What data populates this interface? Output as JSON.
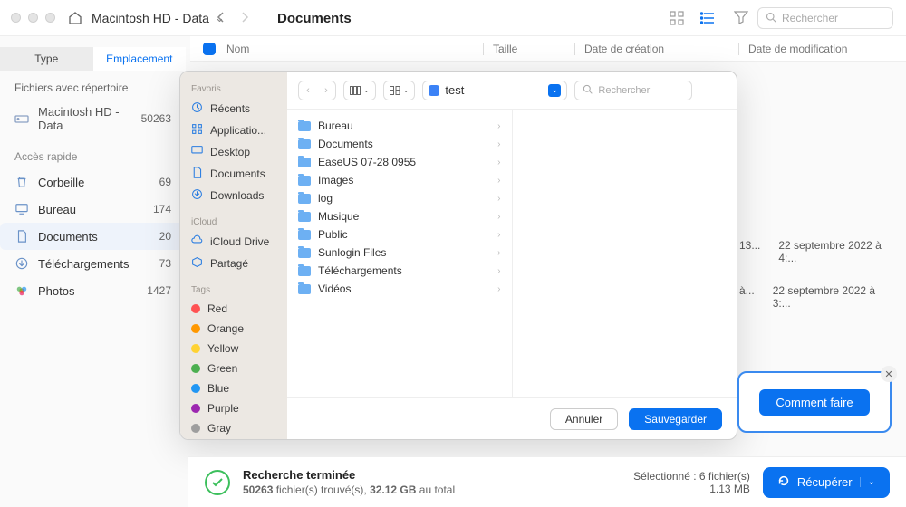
{
  "titlebar": {
    "path": "Macintosh HD - Data"
  },
  "toolbar": {
    "breadcrumb": "Documents",
    "search_placeholder": "Rechercher"
  },
  "columns": {
    "name": "Nom",
    "size": "Taille",
    "created": "Date de création",
    "modified": "Date de modification"
  },
  "sidebar": {
    "tabs": {
      "type": "Type",
      "location": "Emplacement"
    },
    "files_with_dir": "Fichiers avec répertoire",
    "device": {
      "name": "Macintosh HD - Data",
      "count": "50263"
    },
    "quick_h": "Accès rapide",
    "quick": [
      {
        "icon": "trash",
        "label": "Corbeille",
        "count": "69"
      },
      {
        "icon": "desktop",
        "label": "Bureau",
        "count": "174"
      },
      {
        "icon": "doc",
        "label": "Documents",
        "count": "20"
      },
      {
        "icon": "download",
        "label": "Téléchargements",
        "count": "73"
      },
      {
        "icon": "photos",
        "label": "Photos",
        "count": "1427"
      }
    ]
  },
  "peek_rows": [
    {
      "date1": "13...",
      "date2": "22 septembre 2022 à 4:..."
    },
    {
      "date1": "à...",
      "date2": "22 septembre 2022 à 3:..."
    }
  ],
  "dialog": {
    "sidebar": {
      "favorites_h": "Favoris",
      "favorites": [
        {
          "icon": "clock",
          "label": "Récents"
        },
        {
          "icon": "apps",
          "label": "Applicatio..."
        },
        {
          "icon": "desktop",
          "label": "Desktop"
        },
        {
          "icon": "doc",
          "label": "Documents"
        },
        {
          "icon": "download",
          "label": "Downloads"
        }
      ],
      "icloud_h": "iCloud",
      "icloud": [
        {
          "icon": "cloud",
          "label": "iCloud Drive"
        },
        {
          "icon": "shared",
          "label": "Partagé"
        }
      ],
      "tags_h": "Tags",
      "tags": [
        {
          "color": "#ff5252",
          "label": "Red"
        },
        {
          "color": "#ff9800",
          "label": "Orange"
        },
        {
          "color": "#ffd233",
          "label": "Yellow"
        },
        {
          "color": "#4caf50",
          "label": "Green"
        },
        {
          "color": "#2196f3",
          "label": "Blue"
        },
        {
          "color": "#9c27b0",
          "label": "Purple"
        },
        {
          "color": "#9e9e9e",
          "label": "Gray"
        }
      ]
    },
    "path_value": "test",
    "search_placeholder": "Rechercher",
    "folders": [
      "Bureau",
      "Documents",
      "EaseUS 07-28 0955",
      "Images",
      "log",
      "Musique",
      "Public",
      "Sunlogin Files",
      "Téléchargements",
      "Vidéos"
    ],
    "cancel": "Annuler",
    "save": "Sauvegarder"
  },
  "help_button": "Comment faire",
  "status": {
    "title": "Recherche terminée",
    "count_num": "50263",
    "count_suffix": " fichier(s) trouvé(s), ",
    "size_num": "32.12 GB",
    "size_suffix": " au total",
    "selected": "Sélectionné : 6 fichier(s)",
    "selected_size": "1.13 MB",
    "recover": "Récupérer"
  }
}
